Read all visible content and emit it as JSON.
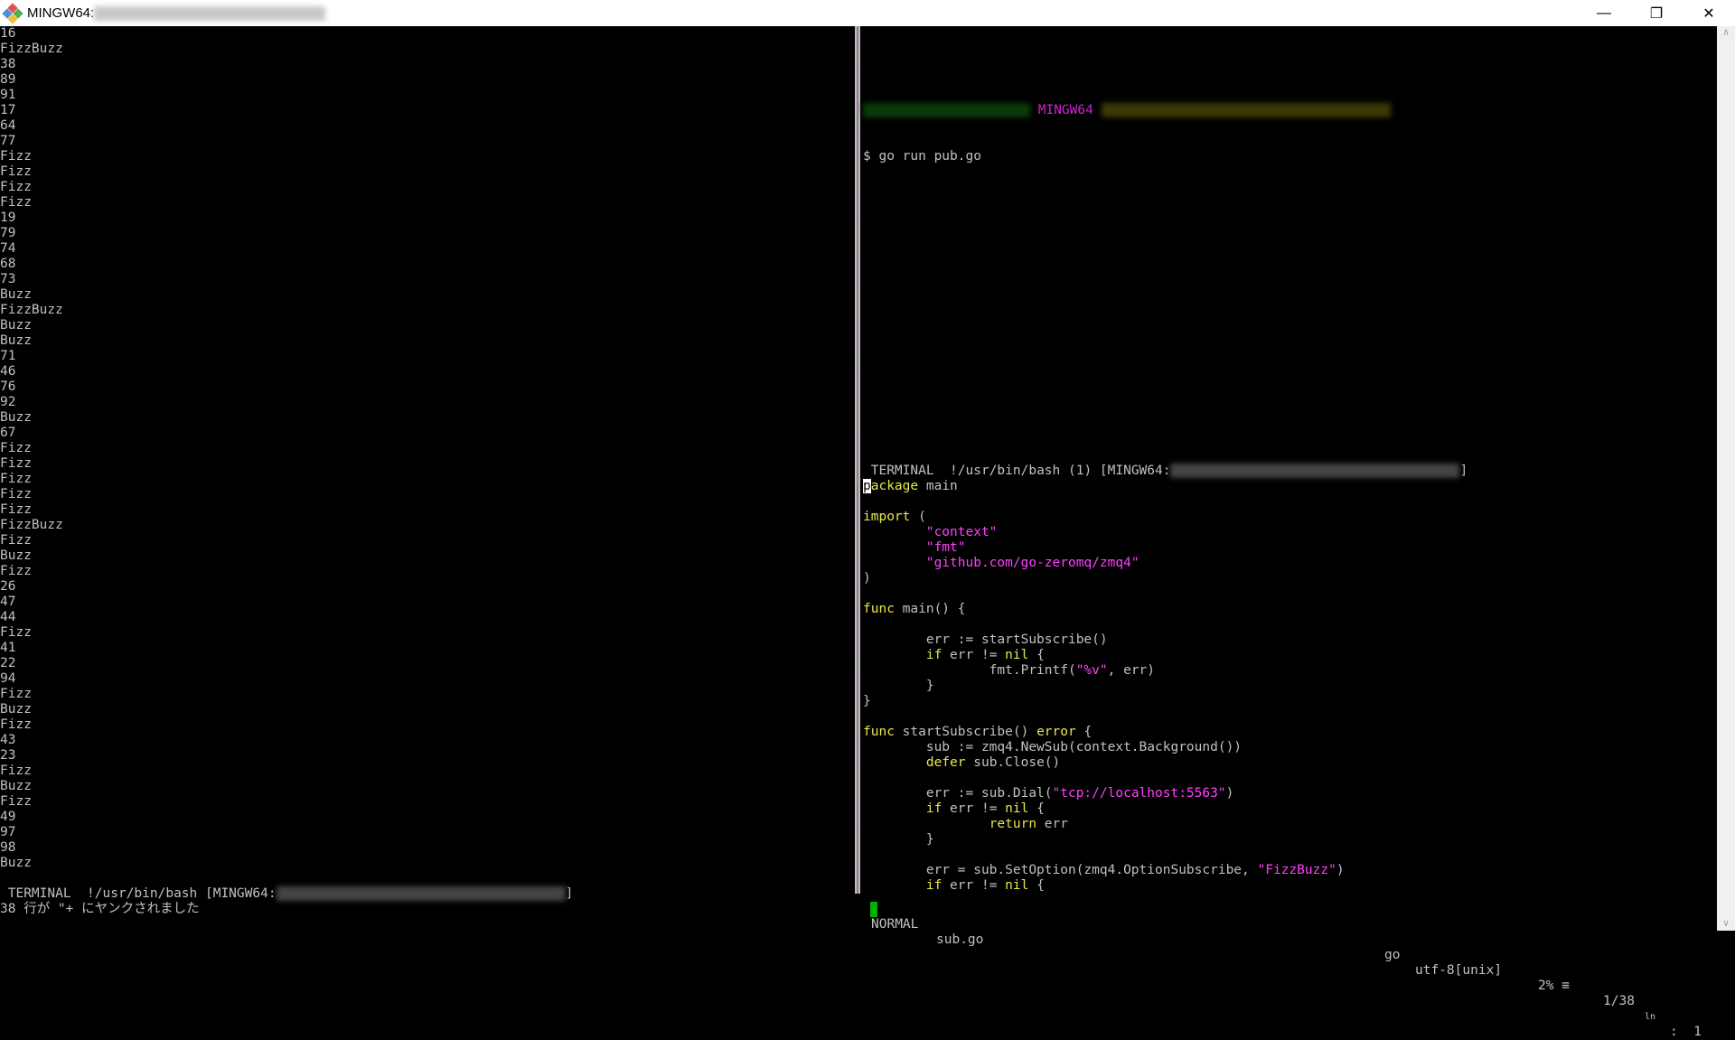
{
  "window": {
    "title": "MINGW64:",
    "minimize": "—",
    "restore": "❐",
    "close": "✕"
  },
  "left_output": [
    "16",
    "FizzBuzz",
    "38",
    "89",
    "91",
    "17",
    "64",
    "77",
    "Fizz",
    "Fizz",
    "Fizz",
    "Fizz",
    "19",
    "79",
    "74",
    "68",
    "73",
    "Buzz",
    "FizzBuzz",
    "Buzz",
    "Buzz",
    "71",
    "46",
    "76",
    "92",
    "Buzz",
    "67",
    "Fizz",
    "Fizz",
    "Fizz",
    "Fizz",
    "Fizz",
    "FizzBuzz",
    "Fizz",
    "Buzz",
    "Fizz",
    "26",
    "47",
    "44",
    "Fizz",
    "41",
    "22",
    "94",
    "Fizz",
    "Buzz",
    "Fizz",
    "43",
    "23",
    "Fizz",
    "Buzz",
    "Fizz",
    "49",
    "97",
    "98",
    "Buzz"
  ],
  "left_status": {
    "label": "TERMINAL",
    "path": "!/usr/bin/bash [MINGW64:",
    "close": "]"
  },
  "message": "38 行が \"+ にヤンクされました",
  "right_terminal": {
    "prompt_host": "MINGW64",
    "command": "$ go run pub.go"
  },
  "right_term_status": {
    "label": "TERMINAL",
    "path": "!/usr/bin/bash (1) [MINGW64:",
    "close": "]"
  },
  "code": [
    [
      [
        "kw",
        "package"
      ],
      [
        "pl",
        " main"
      ]
    ],
    [],
    [
      [
        "kw",
        "import"
      ],
      [
        "pl",
        " ("
      ]
    ],
    [
      [
        "pl",
        "        "
      ],
      [
        "str",
        "\"context\""
      ]
    ],
    [
      [
        "pl",
        "        "
      ],
      [
        "str",
        "\"fmt\""
      ]
    ],
    [
      [
        "pl",
        "        "
      ],
      [
        "str",
        "\"github.com/go-zeromq/zmq4\""
      ]
    ],
    [
      [
        "pl",
        ")"
      ]
    ],
    [],
    [
      [
        "kw",
        "func"
      ],
      [
        "pl",
        " main() {"
      ]
    ],
    [],
    [
      [
        "pl",
        "        err := startSubscribe()"
      ]
    ],
    [
      [
        "pl",
        "        "
      ],
      [
        "kw",
        "if"
      ],
      [
        "pl",
        " err != "
      ],
      [
        "kw",
        "nil"
      ],
      [
        "pl",
        " {"
      ]
    ],
    [
      [
        "pl",
        "                fmt.Printf("
      ],
      [
        "str",
        "\"%v\""
      ],
      [
        "pl",
        ", err)"
      ]
    ],
    [
      [
        "pl",
        "        }"
      ]
    ],
    [
      [
        "pl",
        "}"
      ]
    ],
    [],
    [
      [
        "kw",
        "func"
      ],
      [
        "pl",
        " startSubscribe() "
      ],
      [
        "kw",
        "error"
      ],
      [
        "pl",
        " {"
      ]
    ],
    [
      [
        "pl",
        "        sub := zmq4.NewSub(context.Background())"
      ]
    ],
    [
      [
        "pl",
        "        "
      ],
      [
        "kw",
        "defer"
      ],
      [
        "pl",
        " sub.Close()"
      ]
    ],
    [],
    [
      [
        "pl",
        "        err := sub.Dial("
      ],
      [
        "str",
        "\"tcp://localhost:5563\""
      ],
      [
        "pl",
        ")"
      ]
    ],
    [
      [
        "pl",
        "        "
      ],
      [
        "kw",
        "if"
      ],
      [
        "pl",
        " err != "
      ],
      [
        "kw",
        "nil"
      ],
      [
        "pl",
        " {"
      ]
    ],
    [
      [
        "pl",
        "                "
      ],
      [
        "kw",
        "return"
      ],
      [
        "pl",
        " err"
      ]
    ],
    [
      [
        "pl",
        "        }"
      ]
    ],
    [],
    [
      [
        "pl",
        "        err = sub.SetOption(zmq4.OptionSubscribe, "
      ],
      [
        "str",
        "\"FizzBuzz\""
      ],
      [
        "pl",
        ")"
      ]
    ],
    [
      [
        "pl",
        "        "
      ],
      [
        "kw",
        "if"
      ],
      [
        "pl",
        " err != "
      ],
      [
        "kw",
        "nil"
      ],
      [
        "pl",
        " {"
      ]
    ]
  ],
  "vim_status": {
    "mode": "NORMAL",
    "file": "sub.go",
    "filetype": "go",
    "encoding": "utf-8[unix]",
    "percent": "2% ≡",
    "position": "1/38",
    "ln": "ln",
    "col": ":  1"
  },
  "colors": {
    "keyword": "#e8e84a",
    "string": "#ff40ff",
    "mode_block": "#00b000"
  }
}
